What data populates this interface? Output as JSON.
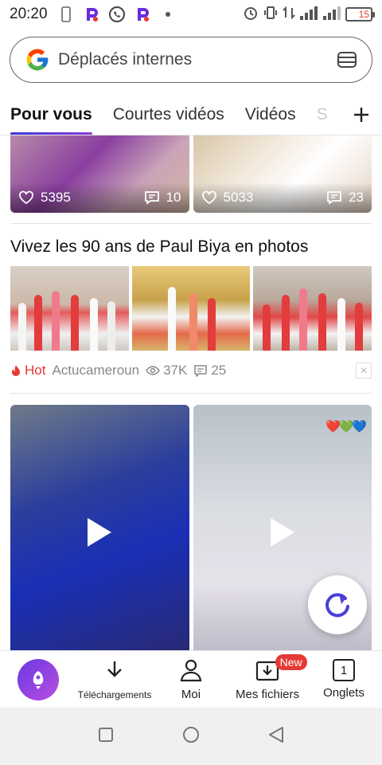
{
  "status_bar": {
    "time": "20:20",
    "battery": "15",
    "icons_left": [
      "sim-icon",
      "pinduoduo-icon",
      "whatsapp-icon",
      "pinduoduo-icon",
      "dot-icon"
    ],
    "icons_right": [
      "alarm-icon",
      "vibrate-icon",
      "data-arrows-icon",
      "signal-icon",
      "signal-icon",
      "battery-icon"
    ]
  },
  "search": {
    "placeholder": "Déplacés internes"
  },
  "tabs": [
    {
      "label": "Pour vous",
      "active": true
    },
    {
      "label": "Courtes vidéos",
      "active": false
    },
    {
      "label": "Vidéos",
      "active": false
    },
    {
      "label": "S",
      "active": false
    }
  ],
  "top_cards": [
    {
      "likes": "5395",
      "comments": "10"
    },
    {
      "likes": "5033",
      "comments": "23"
    }
  ],
  "article": {
    "title": "Vivez les 90 ans de Paul Biya en photos",
    "hot_label": "Hot",
    "source": "Actucameroun",
    "views": "37K",
    "comments": "25"
  },
  "videos": [
    {
      "name": "video-card-1"
    },
    {
      "name": "video-card-2",
      "emoji": "❤️💚💙"
    }
  ],
  "bottom_nav": {
    "downloads": "Téléchargements",
    "me": "Moi",
    "files": "Mes fichiers",
    "files_badge": "New",
    "tabs": "Onglets",
    "tabs_count": "1"
  },
  "colors": {
    "accent": "#5a3be0",
    "hot": "#e53935",
    "fab_icon": "#4a3fd6"
  }
}
